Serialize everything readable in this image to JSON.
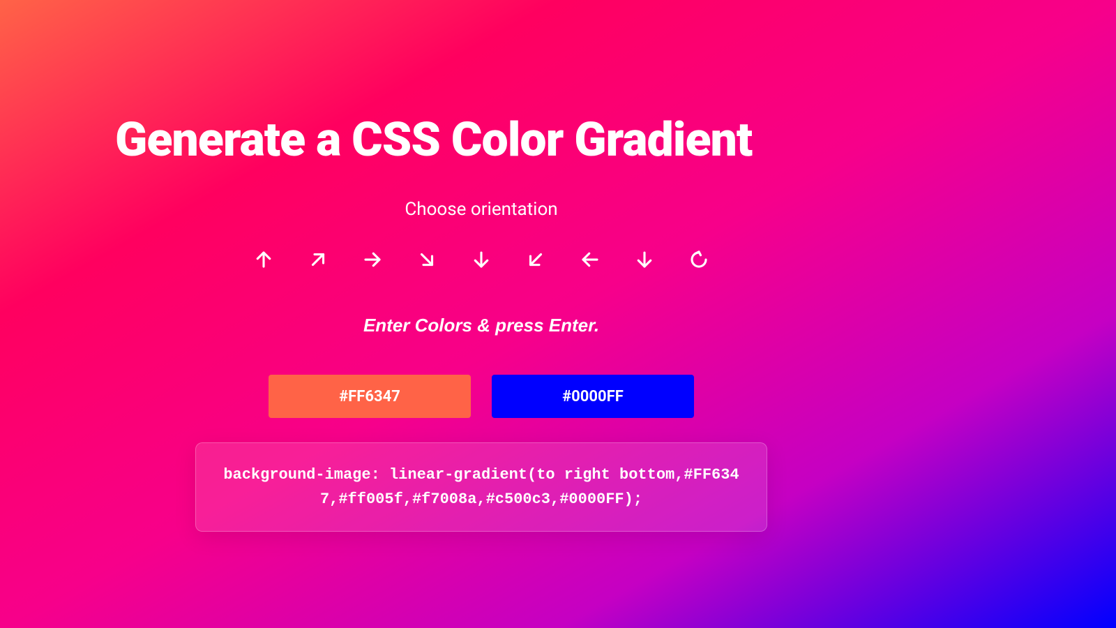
{
  "header": {
    "title": "Generate a CSS Color Gradient",
    "subtitle": "Choose orientation"
  },
  "orientations": [
    {
      "name": "arrow-up-icon"
    },
    {
      "name": "arrow-up-right-icon"
    },
    {
      "name": "arrow-right-icon"
    },
    {
      "name": "arrow-down-right-icon"
    },
    {
      "name": "arrow-down-icon"
    },
    {
      "name": "arrow-down-left-icon"
    },
    {
      "name": "arrow-left-icon"
    },
    {
      "name": "arrow-down-alt-icon"
    },
    {
      "name": "radial-icon"
    }
  ],
  "prompt": {
    "enter_colors": "Enter Colors & press Enter."
  },
  "colors": {
    "color1_value": "#FF6347",
    "color2_value": "#0000FF"
  },
  "output": {
    "css_code": "background-image: linear-gradient(to right bottom,#FF6347,#ff005f,#f7008a,#c500c3,#0000FF);"
  }
}
